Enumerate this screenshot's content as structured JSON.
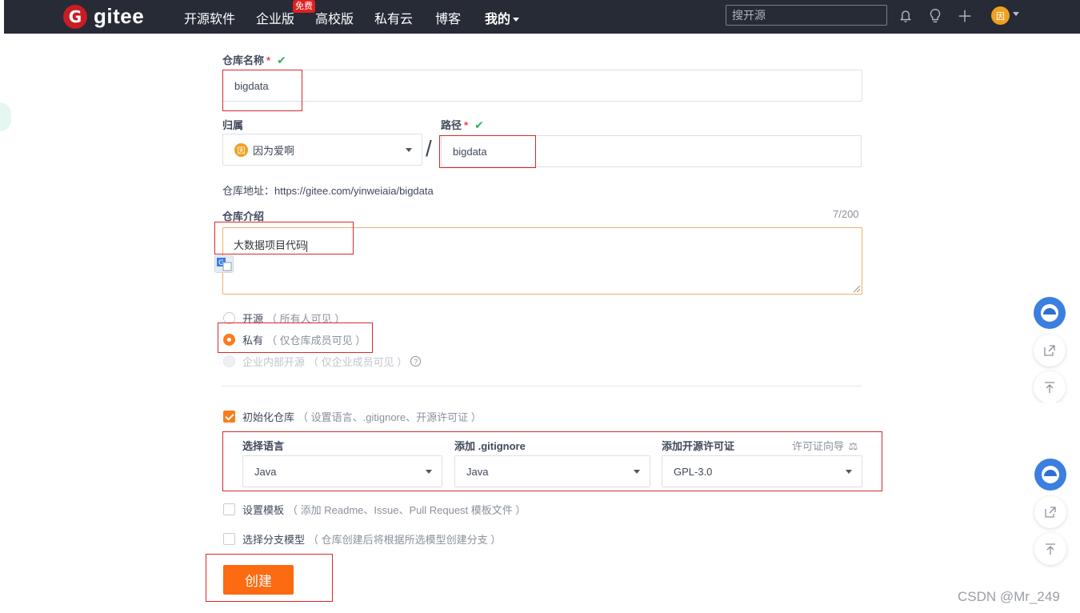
{
  "nav": {
    "logo_letter": "G",
    "logo_text": "gitee",
    "items": [
      "开源软件",
      "企业版",
      "高校版",
      "私有云",
      "博客",
      "我的"
    ],
    "badge": "免费",
    "search_placeholder": "搜开源",
    "avatar_letter": "因"
  },
  "form": {
    "repo_name_label": "仓库名称",
    "required_mark": "*",
    "check_mark": "✔",
    "repo_name_value": "bigdata",
    "owner_label": "归属",
    "owner_value": "因为爱啊",
    "owner_avatar": "因",
    "slash": "/",
    "path_label": "路径",
    "path_value": "bigdata",
    "repo_address": "仓库地址：https://gitee.com/yinweiaia/bigdata",
    "intro_label": "仓库介绍",
    "intro_count": "7/200",
    "intro_value": "大数据项目代码",
    "visibility": {
      "public": {
        "label": "开源",
        "note": "（ 所有人可见 ）"
      },
      "private": {
        "label": "私有",
        "note": "（ 仅仓库成员可见 ）"
      },
      "enterprise": {
        "label": "企业内部开源",
        "note": "（ 仅企业成员可见 ）"
      },
      "selected": "private"
    },
    "init_repo": {
      "label": "初始化仓库",
      "note": "（ 设置语言、.gitignore、开源许可证 ）",
      "checked": true
    },
    "language_label": "选择语言",
    "language_value": "Java",
    "gitignore_label": "添加 .gitignore",
    "gitignore_value": "Java",
    "license_label": "添加开源许可证",
    "license_value": "GPL-3.0",
    "license_wizard": "许可证向导",
    "templates": {
      "label": "设置模板",
      "note": "（ 添加 Readme、Issue、Pull Request 模板文件 ）",
      "checked": false
    },
    "branch_model": {
      "label": "选择分支模型",
      "note": "（ 仓库创建后将根据所选模型创建分支 ）",
      "checked": false
    },
    "create_button": "创建"
  },
  "watermark": "CSDN @Mr_249",
  "colors": {
    "nav_bg": "#262b36",
    "accent": "#fc6a11",
    "highlight_box": "#d8282b",
    "ok": "#3aaf5a"
  }
}
